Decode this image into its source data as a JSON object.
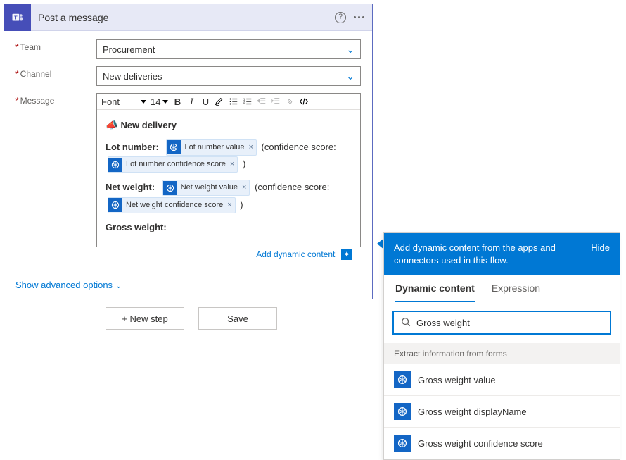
{
  "card": {
    "title": "Post a message",
    "fields": {
      "team": {
        "label": "Team",
        "value": "Procurement"
      },
      "channel": {
        "label": "Channel",
        "value": "New deliveries"
      },
      "message": {
        "label": "Message"
      }
    },
    "editor": {
      "font_label": "Font",
      "font_size": "14",
      "heading": "New delivery",
      "lot_label": "Lot number:",
      "net_label": "Net weight:",
      "gross_label": "Gross weight:",
      "conf_open": "(confidence score:",
      "conf_close": ")",
      "pills": {
        "lot_value": "Lot number value",
        "lot_conf": "Lot number confidence score",
        "net_value": "Net weight value",
        "net_conf": "Net weight confidence score"
      }
    },
    "add_dc": "Add dynamic content",
    "advanced": "Show advanced options"
  },
  "buttons": {
    "new_step": "+ New step",
    "save": "Save"
  },
  "panel": {
    "intro": "Add dynamic content from the apps and connectors used in this flow.",
    "hide": "Hide",
    "tabs": {
      "dc": "Dynamic content",
      "expr": "Expression"
    },
    "search_value": "Gross weight",
    "section": "Extract information from forms",
    "items": [
      "Gross weight value",
      "Gross weight displayName",
      "Gross weight confidence score"
    ]
  }
}
